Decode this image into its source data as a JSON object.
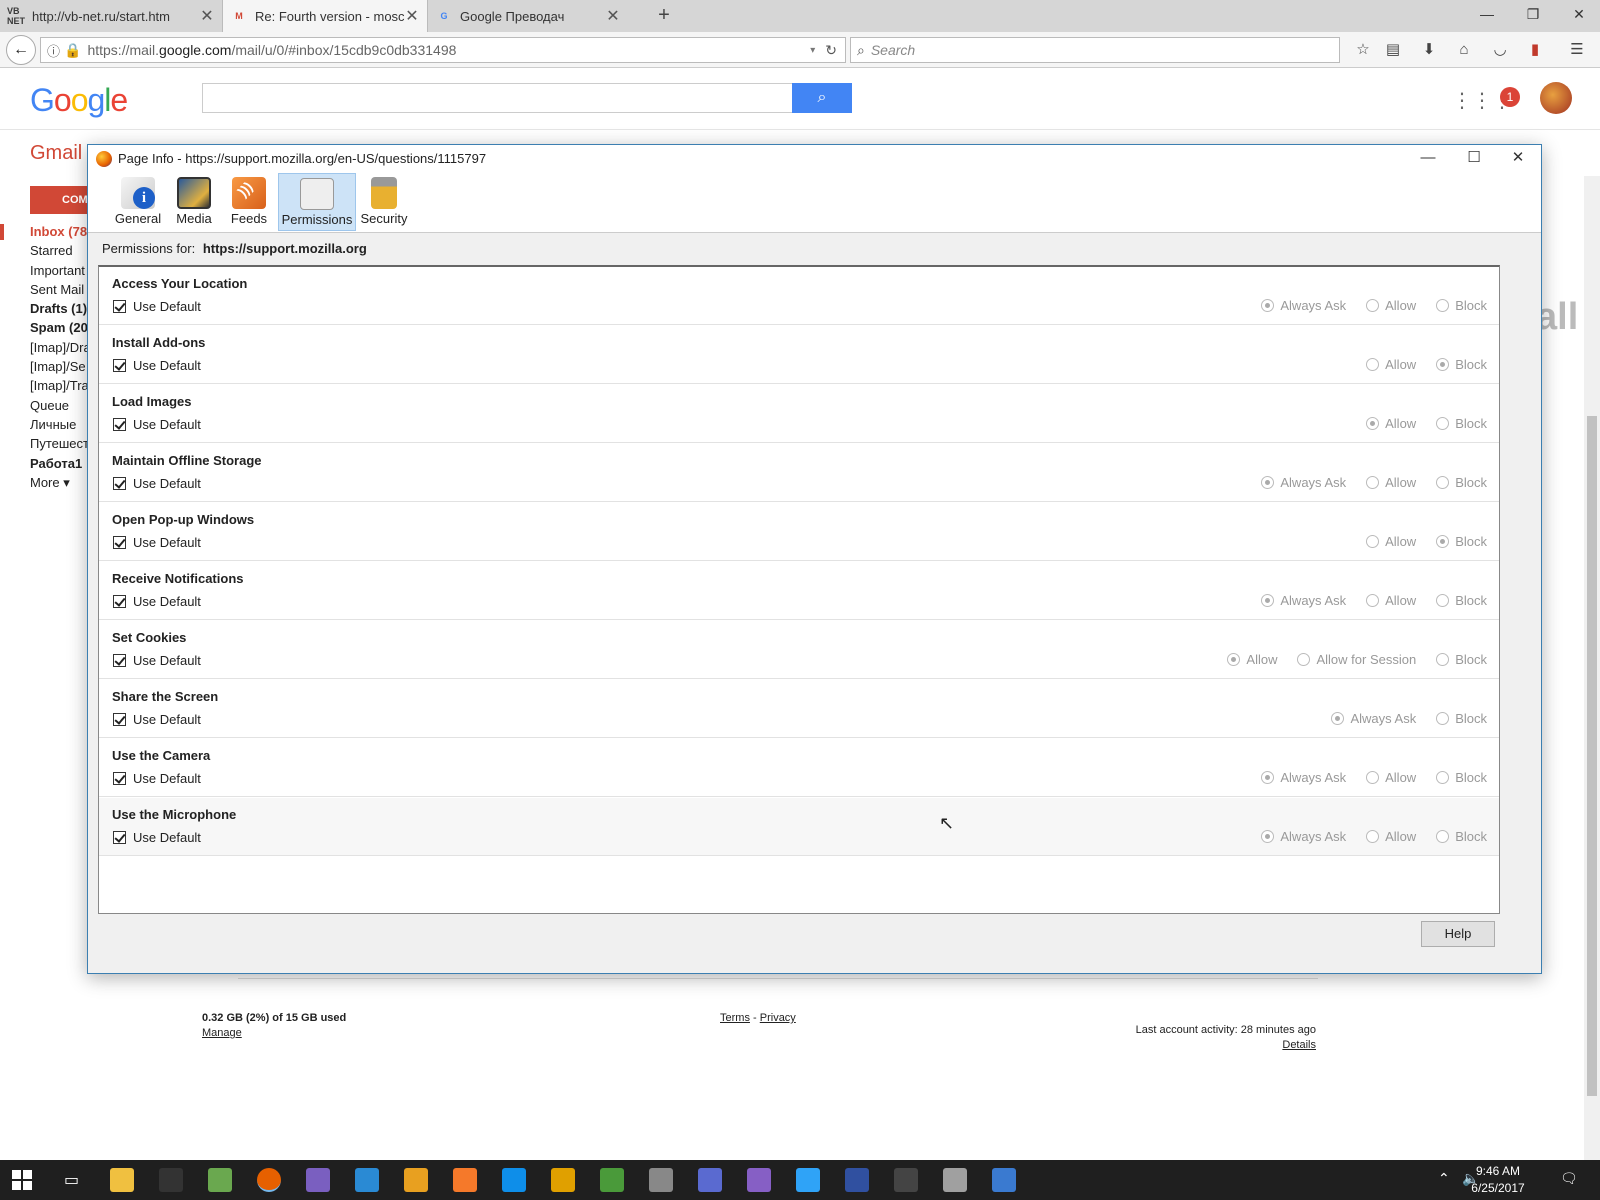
{
  "browser": {
    "tabs": [
      {
        "favicon": "VB NET",
        "title": "http://vb-net.ru/start.htm",
        "color": "#3a3a3a"
      },
      {
        "favicon": "M",
        "title": "Re: Fourth version - moscow",
        "color": "#d14836"
      },
      {
        "favicon": "G",
        "title": "Google Преводач",
        "color": "#4285f4"
      }
    ],
    "new_tab": "+",
    "url_prefix": "https://mail.",
    "url_domain": "google.com",
    "url_path": "/mail/u/0/#inbox/15cdb9c0db331498",
    "search_placeholder": "Search"
  },
  "gmail": {
    "logo": "Google",
    "app_label": "Gmail",
    "compose": "COMPOSE",
    "notifications": "1",
    "nav": [
      {
        "label": "Inbox (78",
        "style": "sel"
      },
      {
        "label": "Starred",
        "style": ""
      },
      {
        "label": "Important",
        "style": ""
      },
      {
        "label": "Sent Mail",
        "style": ""
      },
      {
        "label": "Drafts (1)",
        "style": "bold"
      },
      {
        "label": "Spam (20",
        "style": "bold"
      },
      {
        "label": "[Imap]/Dra",
        "style": ""
      },
      {
        "label": "[Imap]/Se",
        "style": ""
      },
      {
        "label": "[Imap]/Tra",
        "style": ""
      },
      {
        "label": "Queue",
        "style": ""
      },
      {
        "label": "Личные",
        "style": ""
      },
      {
        "label": "Путешест",
        "style": ""
      },
      {
        "label": "Работа1",
        "style": "bold"
      },
      {
        "label": "More ▾",
        "style": ""
      }
    ],
    "storage": "0.32 GB (2%) of 15 GB used",
    "manage": "Manage",
    "terms": "Terms",
    "sep": "-",
    "privacy": "Privacy",
    "activity": "Last account activity: 28 minutes ago",
    "details": "Details"
  },
  "dialog": {
    "title": "Page Info - https://support.mozilla.org/en-US/questions/1115797",
    "tabs": [
      {
        "label": "General",
        "icon": "general-info-icon"
      },
      {
        "label": "Media",
        "icon": "media-icon"
      },
      {
        "label": "Feeds",
        "icon": "rss-feed-icon"
      },
      {
        "label": "Permissions",
        "icon": "permissions-icon"
      },
      {
        "label": "Security",
        "icon": "padlock-icon"
      }
    ],
    "active_tab": "Permissions",
    "permissions_for_label": "Permissions for:",
    "permissions_for_site": "https://support.mozilla.org",
    "use_default_label": "Use Default",
    "permissions": [
      {
        "title": "Access Your Location",
        "use_default": true,
        "options": [
          "Always Ask",
          "Allow",
          "Block"
        ],
        "selected": "Always Ask"
      },
      {
        "title": "Install Add-ons",
        "use_default": true,
        "options": [
          "Allow",
          "Block"
        ],
        "selected": "Block"
      },
      {
        "title": "Load Images",
        "use_default": true,
        "options": [
          "Allow",
          "Block"
        ],
        "selected": "Allow"
      },
      {
        "title": "Maintain Offline Storage",
        "use_default": true,
        "options": [
          "Always Ask",
          "Allow",
          "Block"
        ],
        "selected": "Always Ask"
      },
      {
        "title": "Open Pop-up Windows",
        "use_default": true,
        "options": [
          "Allow",
          "Block"
        ],
        "selected": "Block"
      },
      {
        "title": "Receive Notifications",
        "use_default": true,
        "options": [
          "Always Ask",
          "Allow",
          "Block"
        ],
        "selected": "Always Ask"
      },
      {
        "title": "Set Cookies",
        "use_default": true,
        "options": [
          "Allow",
          "Allow for Session",
          "Block"
        ],
        "selected": "Allow"
      },
      {
        "title": "Share the Screen",
        "use_default": true,
        "options": [
          "Always Ask",
          "Block"
        ],
        "selected": "Always Ask"
      },
      {
        "title": "Use the Camera",
        "use_default": true,
        "options": [
          "Always Ask",
          "Allow",
          "Block"
        ],
        "selected": "Always Ask"
      },
      {
        "title": "Use the Microphone",
        "use_default": true,
        "options": [
          "Always Ask",
          "Allow",
          "Block"
        ],
        "selected": "Always Ask"
      }
    ],
    "help": "Help"
  },
  "taskbar": {
    "time": "9:46 AM",
    "date": "6/25/2017",
    "apps": [
      {
        "name": "file-explorer-icon",
        "color": "#f0c040"
      },
      {
        "name": "terminal-icon",
        "color": "#333333"
      },
      {
        "name": "photos-icon",
        "color": "#6aa84f"
      },
      {
        "name": "firefox-icon",
        "color": "#e66000"
      },
      {
        "name": "app-icon-5",
        "color": "#7a5fc0"
      },
      {
        "name": "app-icon-6",
        "color": "#2a8ad4"
      },
      {
        "name": "app-icon-7",
        "color": "#e8a020"
      },
      {
        "name": "blender-icon",
        "color": "#f5792a"
      },
      {
        "name": "teamviewer-icon",
        "color": "#0e8ee9"
      },
      {
        "name": "app-icon-10",
        "color": "#e0a000"
      },
      {
        "name": "app-icon-11",
        "color": "#4a9a3a"
      },
      {
        "name": "app-icon-12",
        "color": "#888888"
      },
      {
        "name": "app-icon-13",
        "color": "#5a6ad0"
      },
      {
        "name": "visual-studio-icon",
        "color": "#865fc5"
      },
      {
        "name": "photoshop-icon",
        "color": "#2fa3f7"
      },
      {
        "name": "app-icon-16",
        "color": "#3050a0"
      },
      {
        "name": "app-icon-17",
        "color": "#444444"
      },
      {
        "name": "app-icon-18",
        "color": "#a0a0a0"
      },
      {
        "name": "app-icon-19",
        "color": "#3a7ad0"
      }
    ],
    "colors": {
      "accent": "#76b9ed",
      "bar": "#1f1f1f"
    }
  }
}
